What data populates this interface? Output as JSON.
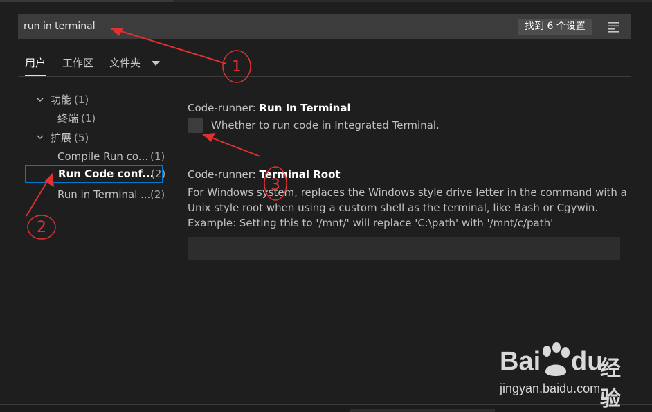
{
  "search": {
    "query": "run in terminal",
    "result_count": "找到 6 个设置",
    "clear_icon": "clear-filter-icon"
  },
  "tabs": [
    {
      "label": "用户",
      "active": true
    },
    {
      "label": "工作区",
      "active": false
    },
    {
      "label": "文件夹",
      "active": false
    }
  ],
  "tree": {
    "groups": [
      {
        "label": "功能",
        "count": "(1)",
        "children": [
          {
            "label": "终端",
            "count": "(1)"
          }
        ]
      },
      {
        "label": "扩展",
        "count": "(5)",
        "children": [
          {
            "label": "Compile Run co...",
            "count": "(1)",
            "selected": false
          },
          {
            "label": "Run Code conf...",
            "count": "(2)",
            "selected": true
          },
          {
            "label": "Run in Terminal ...",
            "count": "(2)",
            "selected": false
          }
        ]
      }
    ]
  },
  "settings": [
    {
      "prefix": "Code-runner: ",
      "name": "Run In Terminal",
      "description": "Whether to run code in Integrated Terminal.",
      "checked": false
    },
    {
      "prefix": "Code-runner: ",
      "name": "Terminal Root",
      "description": "For Windows system, replaces the Windows style drive letter in the command with a Unix style root when using a custom shell as the terminal, like Bash or Cgywin. Example: Setting this to '/mnt/' will replace 'C:\\path' with '/mnt/c/path'",
      "value": ""
    }
  ],
  "annotations": {
    "color": "#e03030",
    "labels": [
      "1",
      "2",
      "3"
    ]
  },
  "watermark": {
    "brand_left": "Bai",
    "brand_right": "du",
    "brand_cn": "经验",
    "url": "jingyan.baidu.com",
    "color": "#d9d9d9"
  }
}
